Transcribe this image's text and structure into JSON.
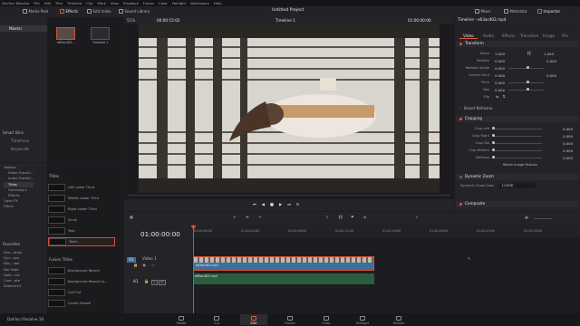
{
  "menubar": {
    "items": [
      "DaVinci Resolve",
      "File",
      "Edit",
      "Trim",
      "Timeline",
      "Clip",
      "Mark",
      "View",
      "Playback",
      "Fusion",
      "Color",
      "Fairlight",
      "Workspace",
      "Help"
    ]
  },
  "toolbar": {
    "media_pool": "Media Pool",
    "effects": "Effects",
    "edit_index": "Edit Index",
    "sound_library": "Sound Library",
    "project_title": "Untitled Project",
    "mixer": "Mixer",
    "metadata": "Metadata",
    "inspector": "Inspector"
  },
  "media_pool": {
    "master": "Master",
    "zoom": "51%",
    "clip1": "e63ac402...",
    "clip2": "Timeline 1",
    "smart_bins": "Smart Bins",
    "smart_items": [
      "Timelines",
      "Keywords"
    ]
  },
  "viewer": {
    "timecode_left": "00:00:15:02",
    "timeline_name": "Timeline 1",
    "timecode_right": "01:00:00:00"
  },
  "effects": {
    "tree": [
      "Toolbox",
      "Video Transiti...",
      "Audio Transiti...",
      "Titles",
      "Generators",
      "Effects",
      "Open FX",
      "Filters"
    ],
    "favorites_label": "Favorites",
    "favorites": [
      "Dim...ation",
      "Syn...ype",
      "Nos...ube",
      "Nor Fade",
      "Dolb...cut",
      "Cam...ate",
      "Zoomer43"
    ],
    "titles_header": "Titles",
    "titles": [
      "Left Lower Third",
      "Middle Lower Third",
      "Right Lower Third",
      "Scroll",
      "Text",
      "Text+"
    ],
    "fusion_header": "Fusion Titles",
    "fusion_titles": [
      "Background Reveal",
      "Background Reveal Lo...",
      "Call Out",
      "Center Reveal"
    ]
  },
  "inspector": {
    "clip_name": "Timeline - e63ac402.mp4",
    "tabs": [
      "Video",
      "Audio",
      "Effects",
      "Transition",
      "Image",
      "File"
    ],
    "transform": "Transform",
    "transform_rows": [
      {
        "label": "Zoom",
        "x": "1.000",
        "y": "1.000"
      },
      {
        "label": "Position",
        "x": "0.000",
        "y": "0.000"
      },
      {
        "label": "Rotation Angle",
        "x": "0.000",
        "y": ""
      },
      {
        "label": "Anchor Point",
        "x": "0.000",
        "y": "0.000"
      },
      {
        "label": "Pitch",
        "x": "0.000",
        "y": ""
      },
      {
        "label": "Yaw",
        "x": "0.000",
        "y": ""
      },
      {
        "label": "Flip",
        "x": "",
        "y": ""
      }
    ],
    "smart_reframe": "Smart Reframe",
    "cropping": "Cropping",
    "crop_rows": [
      {
        "label": "Crop Left",
        "v": "0.000"
      },
      {
        "label": "Crop Right",
        "v": "0.000"
      },
      {
        "label": "Crop Top",
        "v": "0.000"
      },
      {
        "label": "Crop Bottom",
        "v": "0.000"
      },
      {
        "label": "Softness",
        "v": "0.000"
      }
    ],
    "retain": "Retain Image Position",
    "dynamic_zoom": "Dynamic Zoom",
    "dz_ease_label": "Dynamic Zoom Ease",
    "dz_ease": "Linear",
    "composite": "Composite"
  },
  "timeline": {
    "timecode": "01:00:00:00",
    "ruler": [
      "01:00:00:00",
      "01:00:04:00",
      "01:00:08:00",
      "01:00:12:00",
      "01:00:16:00",
      "01:00:20:00",
      "01:00:24:00",
      "01:00:28:00"
    ],
    "v1": "V1",
    "v1_name": "Video 1",
    "a1": "A1",
    "clip_video": "e63ac402.mp4",
    "clip_audio": "e63ac402.mp4"
  },
  "pages": [
    "Media",
    "Cut",
    "Edit",
    "Fusion",
    "Color",
    "Fairlight",
    "Deliver"
  ],
  "app_name": "DaVinci Resolve 18",
  "colors": {
    "accent": "#e05a3a",
    "clip": "#3d6f9c",
    "playhead": "#e04a30"
  }
}
